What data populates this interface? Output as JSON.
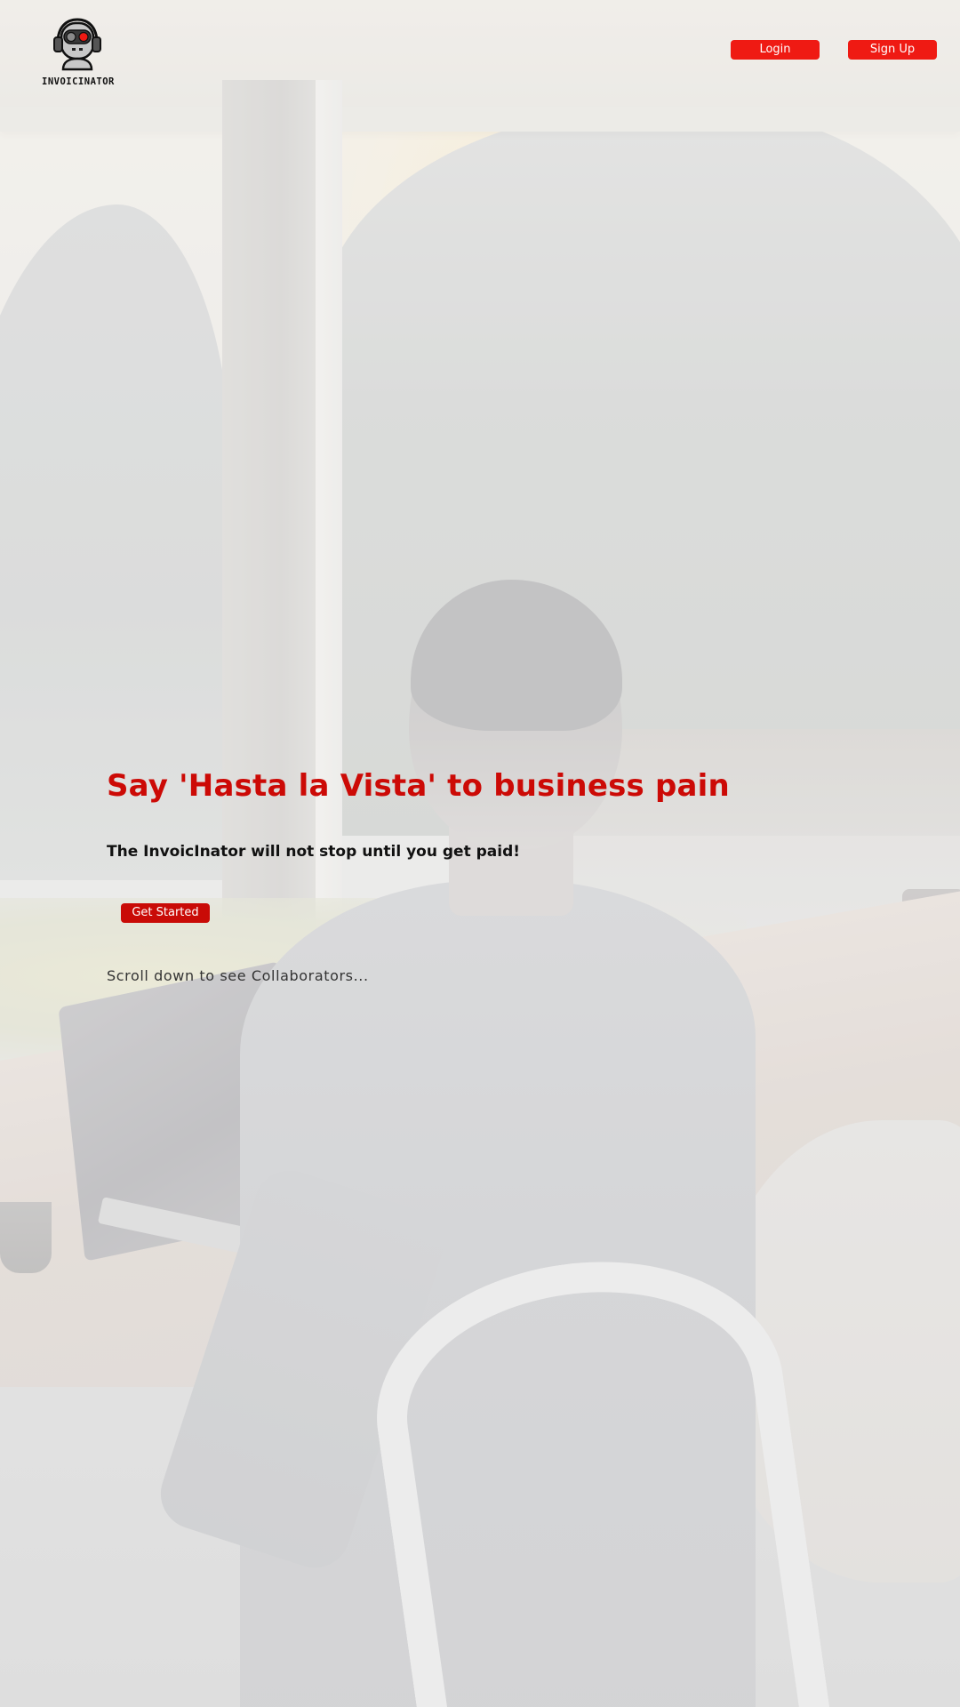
{
  "brand": {
    "name": "INVOICINATOR",
    "logo_icon": "robot-headphones-icon",
    "accent_color": "#ef1a13"
  },
  "nav": {
    "login_label": "Login",
    "signup_label": "Sign Up"
  },
  "hero": {
    "title": "Say 'Hasta la Vista' to business pain",
    "subtitle": "The InvoicInator will not stop until you get paid!",
    "cta_label": "Get Started",
    "scroll_hint": "Scroll down to see Collaborators...",
    "title_color": "#cc0a06"
  },
  "background": {
    "image_description_icon": "office-photo-background"
  }
}
